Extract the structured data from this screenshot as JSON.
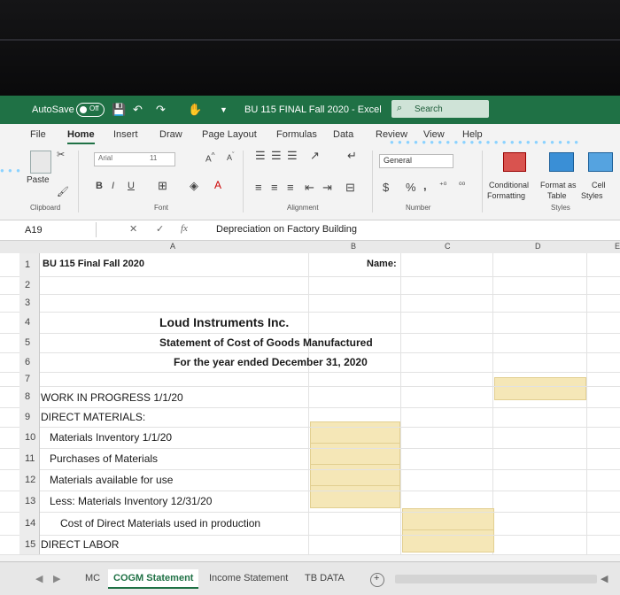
{
  "titlebar": {
    "autosave_label": "AutoSave",
    "autosave_state": "Off",
    "file_title": "BU 115 FINAL Fall 2020  -  Excel",
    "search_placeholder": "Search",
    "accent_color": "#1f7145"
  },
  "menus": [
    "File",
    "Home",
    "Insert",
    "Draw",
    "Page Layout",
    "Formulas",
    "Data",
    "Review",
    "View",
    "Help"
  ],
  "ribbon": {
    "paste": "Paste",
    "font_name": "Arial",
    "font_size": "11",
    "bold": "B",
    "italic": "I",
    "underline": "U",
    "number_format": "General",
    "currency": "$",
    "percent": "%",
    "comma": ",",
    "conditional_1": "Conditional",
    "conditional_2": "Formatting",
    "format_as_1": "Format as",
    "format_as_2": "Table",
    "cell_1": "Cell",
    "cell_2": "Styles",
    "groups": {
      "clipboard": "Clipboard",
      "font": "Font",
      "alignment": "Alignment",
      "number": "Number",
      "styles": "Styles"
    }
  },
  "formula_bar": {
    "name_box": "A19",
    "fx": "fx",
    "content": "Depreciation on Factory Building"
  },
  "columns": [
    "A",
    "B",
    "C",
    "D",
    "E"
  ],
  "rows": [
    {
      "num": "1",
      "a": "BU 115 Final Fall 2020",
      "b": "Name:"
    },
    {
      "num": "2"
    },
    {
      "num": "3"
    },
    {
      "num": "4",
      "a": "Loud Instruments Inc."
    },
    {
      "num": "5",
      "a": "Statement of Cost of Goods Manufactured"
    },
    {
      "num": "6",
      "a": "For the year ended December 31, 2020"
    },
    {
      "num": "7"
    },
    {
      "num": "8",
      "a": "WORK IN PROGRESS 1/1/20"
    },
    {
      "num": "9",
      "a": "DIRECT MATERIALS:"
    },
    {
      "num": "10",
      "a": "Materials Inventory 1/1/20"
    },
    {
      "num": "11",
      "a": "Purchases of Materials"
    },
    {
      "num": "12",
      "a": "Materials available for use"
    },
    {
      "num": "13",
      "a": "Less: Materials Inventory 12/31/20"
    },
    {
      "num": "14",
      "a": "Cost of Direct Materials used in production"
    },
    {
      "num": "15",
      "a": "DIRECT LABOR"
    }
  ],
  "sheet_tabs": [
    "MC",
    "COGM Statement",
    "Income Statement",
    "TB DATA"
  ],
  "active_tab": "COGM Statement",
  "input_highlight_color": "#f5e7b7"
}
